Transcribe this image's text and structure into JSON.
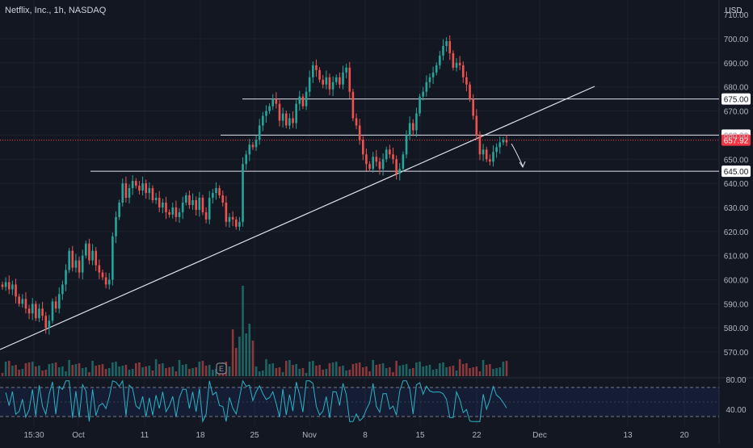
{
  "header": {
    "symbol_label": "Netflix, Inc., 1h, NASDAQ",
    "currency": "USD"
  },
  "colors": {
    "bg": "#131722",
    "grid": "#1e2230",
    "text": "#b2b5be",
    "up": "#26a69a",
    "down": "#ef5350",
    "line": "#e0e3eb",
    "rsi": "#2bb3c8",
    "price_tag": "#f23645"
  },
  "chart_data": [
    {
      "type": "candlestick",
      "title": "Netflix, Inc., 1h, NASDAQ",
      "ylabel": "",
      "ylim": [
        563,
        707
      ],
      "x_ticks": [
        "15:30",
        "Oct",
        "11",
        "18",
        "25",
        "Nov",
        "8",
        "15",
        "22",
        "Dec",
        "13",
        "20"
      ],
      "y_ticks": [
        570,
        580,
        590,
        600,
        610,
        620,
        630,
        640,
        650,
        660,
        670,
        680,
        690,
        700
      ],
      "top_tick_partial": "710.00",
      "current_price": 657.92,
      "current_price_label": "657.92",
      "horizontal_levels": [
        {
          "value": 675,
          "label": "675.00"
        },
        {
          "value": 660,
          "label": "660.00"
        },
        {
          "value": 645,
          "label": "645.00"
        }
      ],
      "trendline": {
        "from": {
          "x": "start",
          "y": 570
        },
        "to": {
          "x": "late Nov",
          "y": 679
        }
      },
      "approximate_closes": [
        597,
        599,
        596,
        598,
        593,
        590,
        592,
        588,
        586,
        590,
        584,
        588,
        585,
        580,
        583,
        591,
        588,
        594,
        598,
        604,
        612,
        605,
        608,
        603,
        610,
        615,
        608,
        612,
        606,
        603,
        601,
        598,
        600,
        618,
        626,
        632,
        640,
        634,
        638,
        641,
        639,
        637,
        640,
        636,
        638,
        633,
        634,
        630,
        632,
        628,
        627,
        630,
        626,
        628,
        632,
        635,
        631,
        633,
        629,
        634,
        628,
        625,
        634,
        636,
        638,
        635,
        632,
        624,
        626,
        625,
        622,
        624,
        648,
        652,
        656,
        655,
        658,
        664,
        668,
        670,
        672,
        675,
        673,
        666,
        669,
        664,
        667,
        665,
        673,
        676,
        672,
        678,
        684,
        689,
        687,
        683,
        681,
        684,
        679,
        682,
        684,
        681,
        686,
        688,
        678,
        667,
        664,
        658,
        652,
        648,
        646,
        651,
        649,
        646,
        650,
        654,
        652,
        650,
        644,
        646,
        652,
        660,
        665,
        662,
        669,
        676,
        678,
        682,
        684,
        686,
        689,
        693,
        697,
        699,
        694,
        688,
        690,
        689,
        684,
        681,
        675,
        668,
        660,
        652,
        654,
        650,
        649,
        653,
        655,
        657,
        658,
        657
      ],
      "volume": {
        "event_marker": "E"
      },
      "rsi": {
        "levels": [
          70,
          30
        ],
        "tick_labels": [
          "80.00",
          "40.00"
        ]
      },
      "forecast_arrow": "down"
    }
  ]
}
